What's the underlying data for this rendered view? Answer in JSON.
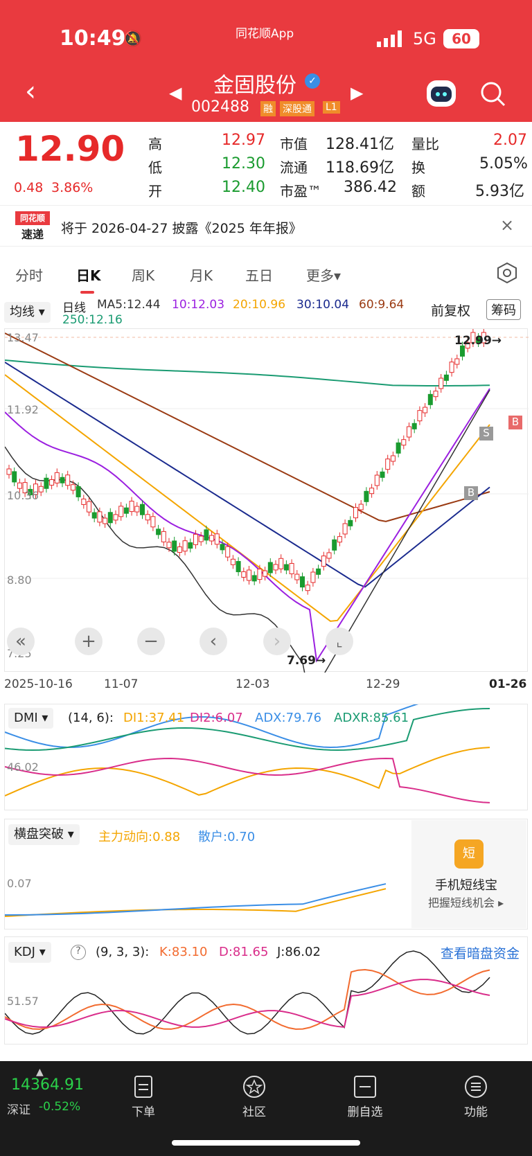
{
  "status": {
    "time": "10:49",
    "app": "同花顺App",
    "network": "5G",
    "battery": "60"
  },
  "header": {
    "name": "金固股份",
    "code": "002488",
    "tags": [
      "融",
      "深股通",
      "L1"
    ]
  },
  "quote": {
    "price": "12.90",
    "change": "0.48",
    "pct": "3.86%",
    "rows": [
      [
        "高",
        "12.97",
        "市值",
        "128.41亿",
        "量比",
        "2.07"
      ],
      [
        "低",
        "12.30",
        "流通",
        "118.69亿",
        "换",
        "5.05%"
      ],
      [
        "开",
        "12.40",
        "市盈™",
        "386.42",
        "额",
        "5.93亿"
      ]
    ]
  },
  "notice": {
    "logo1": "同花顺",
    "logo2": "速递",
    "text": "将于 2026-04-27 披露《2025 年年报》"
  },
  "tabs": [
    "分时",
    "日K",
    "周K",
    "月K",
    "五日",
    "更多▾"
  ],
  "ma": {
    "selector": "均线",
    "period": "日线",
    "ma5": "MA5:12.44",
    "ma10": "10:12.03",
    "ma20": "20:10.96",
    "ma30": "30:10.04",
    "ma60": "60:9.64",
    "ma250": "250:12.16",
    "adjust": "前复权",
    "chip": "筹码"
  },
  "chart_data": {
    "type": "candlestick",
    "y_ticks": [
      "13.47",
      "11.92",
      "10.36",
      "8.80",
      "7.25"
    ],
    "x_ticks": [
      "2025-10-16",
      "11-07",
      "12-03",
      "12-29",
      "01-26"
    ],
    "high_label": "12.99→",
    "low_label": "7.69→",
    "signals": [
      "S",
      "B",
      "B"
    ]
  },
  "dmi": {
    "selector": "DMI",
    "params": "(14, 6):",
    "di1": "DI1:37.41",
    "di2": "DI2:6.07",
    "adx": "ADX:79.76",
    "adxr": "ADXR:85.61",
    "tick": "46.02"
  },
  "hp": {
    "selector": "横盘突破",
    "main": "主力动向:0.88",
    "retail": "散户:0.70",
    "tick": "0.07",
    "ad_title": "手机短线宝",
    "ad_sub": "把握短线机会 ▸",
    "ad_icon": "短"
  },
  "kdj": {
    "selector": "KDJ",
    "params": "(9, 3, 3):",
    "k": "K:83.10",
    "d": "D:81.65",
    "j": "J:86.02",
    "link": "查看暗盘资金",
    "tick": "51.57"
  },
  "footer": {
    "index": "14364.91",
    "index_name": "深证",
    "index_pct": "-0.52%",
    "items": [
      "下单",
      "社区",
      "删自选",
      "功能"
    ]
  },
  "colors": {
    "header": "#e93a3f",
    "up": "#e62929",
    "down": "#1a9b2f"
  }
}
